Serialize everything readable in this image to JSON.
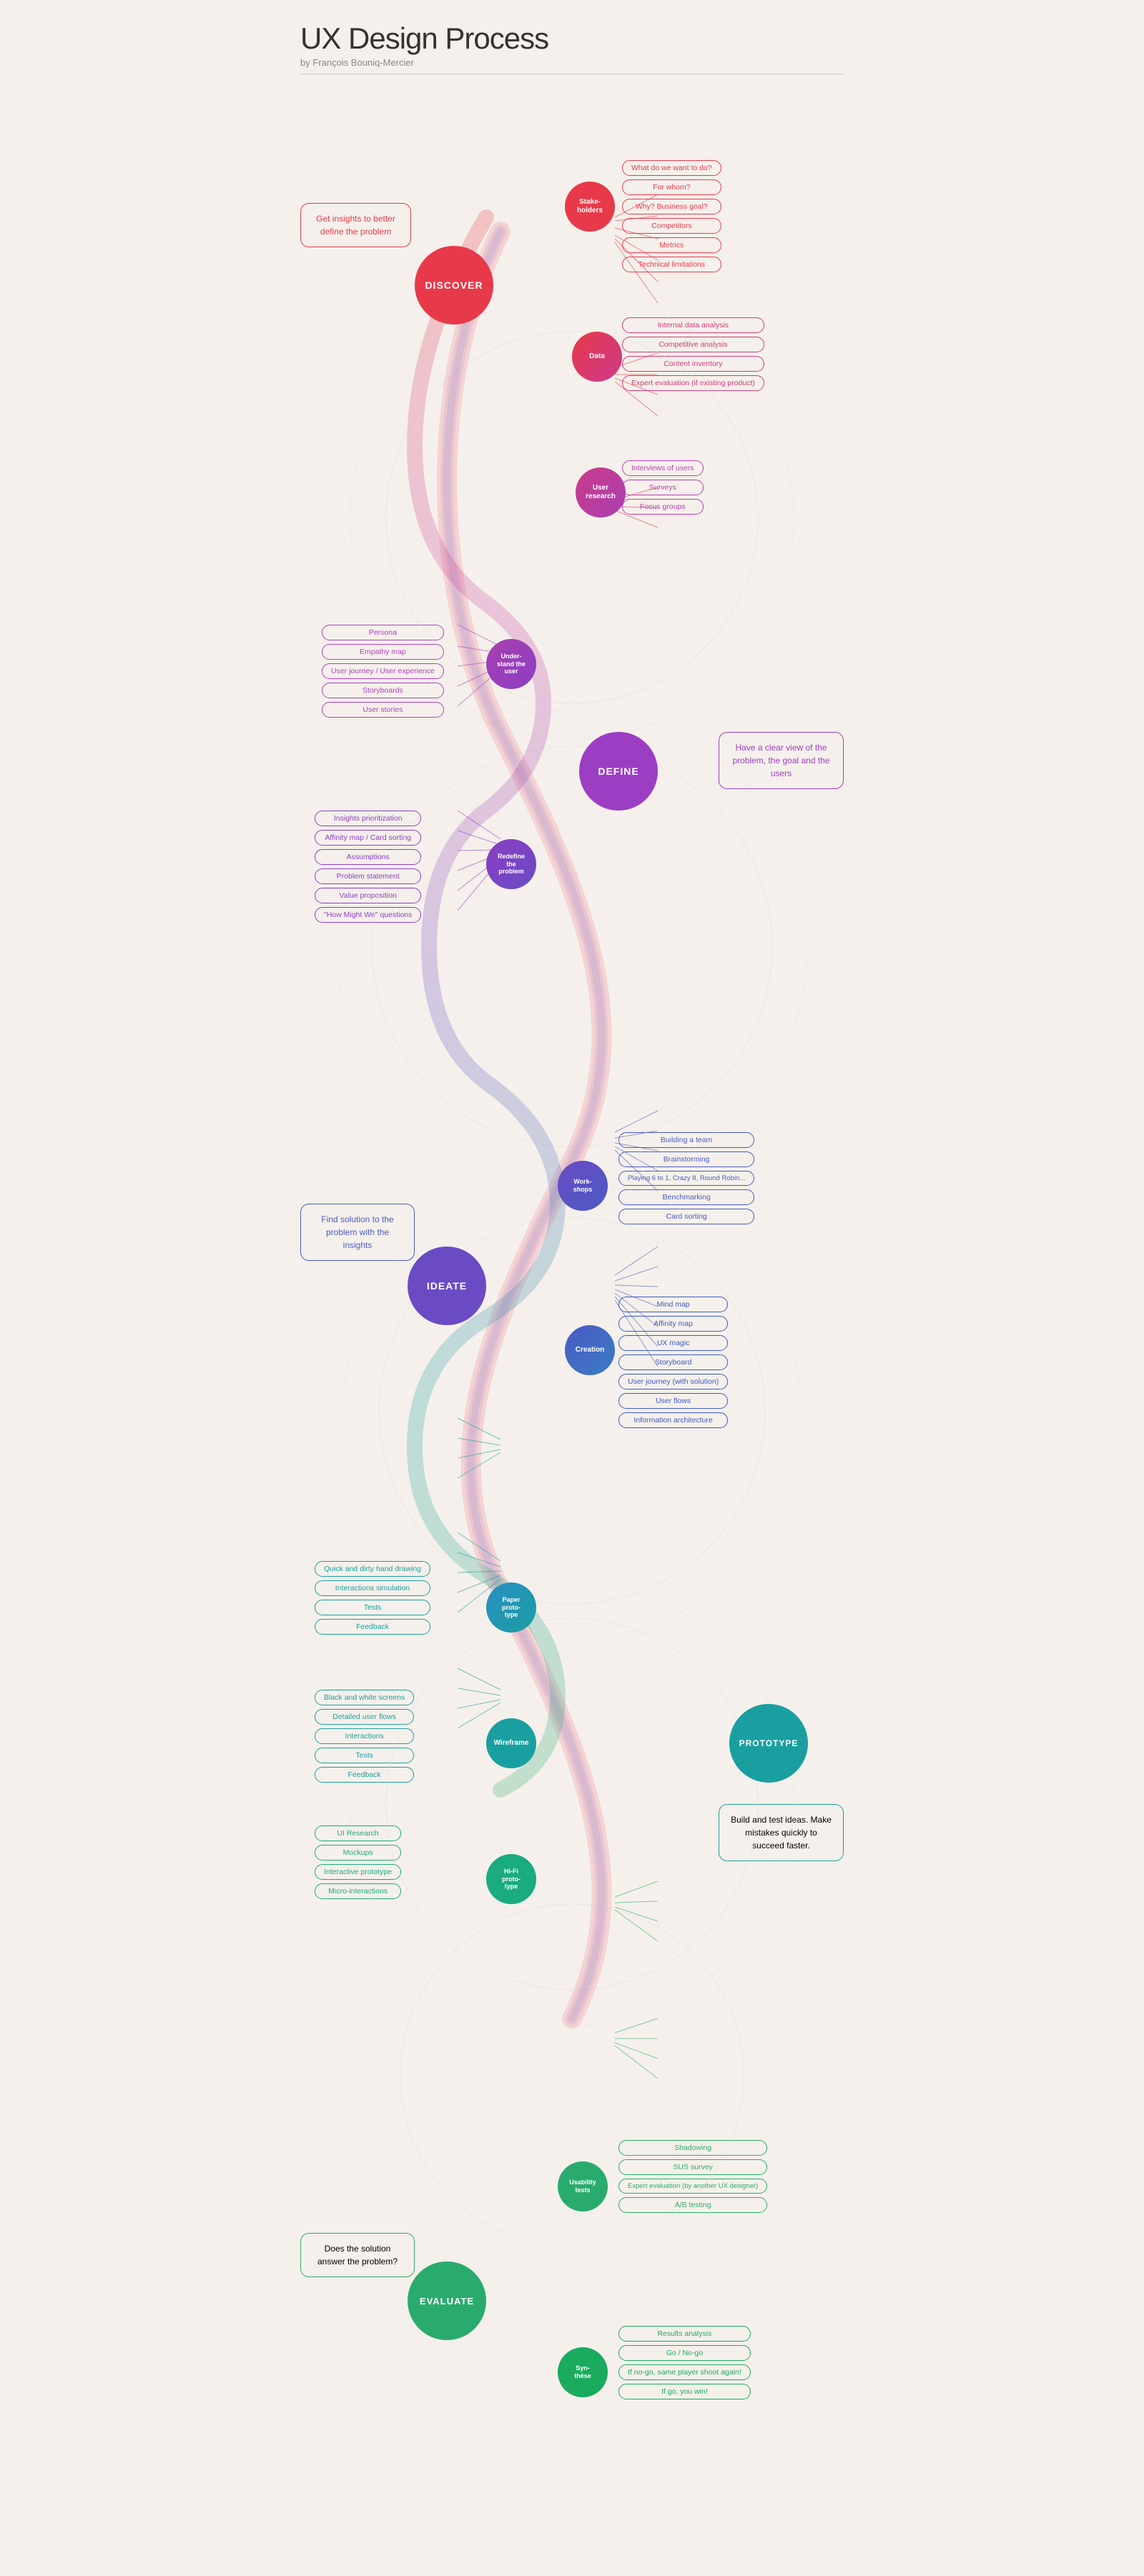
{
  "title": "UX Design Process",
  "author": "by François Bouniq-Mercier",
  "phases": {
    "discover": {
      "label": "DISCOVER",
      "description": "Get insights to better define the problem",
      "stakeholders_label": "Stake-\nholders",
      "stakeholders_pills": [
        "What do we want to do?",
        "For whom?",
        "Why? Business goal?",
        "Competitors",
        "Metrics",
        "Technical limitations"
      ],
      "data_label": "Data",
      "data_pills": [
        "Internal data analysis",
        "Competitive analysis",
        "Content inventory",
        "Expert evaluation (if existing product)"
      ],
      "user_research_label": "User\nresearch",
      "user_research_pills": [
        "Interviews of users",
        "Surveys",
        "Focus groups"
      ]
    },
    "define": {
      "label": "DEFINE",
      "description": "Have a clear view of the problem, the goal and the users",
      "understand_label": "Under-\nstand the\nuser",
      "understand_pills": [
        "Persona",
        "Empathy map",
        "User journey / User experience",
        "Storyboards",
        "User stories"
      ],
      "redefine_label": "Redefine\nthe\nproblem",
      "redefine_pills": [
        "Insights prioritization",
        "Affinity map / Card sorting",
        "Assumptions",
        "Problem statement",
        "Value proposition",
        "\"How Might We\" questions"
      ]
    },
    "ideate": {
      "label": "IDEATE",
      "description": "Find solution to the problem with the insights",
      "workshops_label": "Workshops",
      "workshops_pills": [
        "Building a team",
        "Brainstorming",
        "Playing 6 to 1, Crazy 8, Round Robin...",
        "Benchmarking",
        "Card sorting"
      ],
      "creation_label": "Creation",
      "creation_pills": [
        "Mind map",
        "Affinity map",
        "UX magic",
        "Storyboard",
        "User journey (with solution)",
        "User flows",
        "Information architecture"
      ]
    },
    "prototype": {
      "label": "PROTOTYPE",
      "description": "Build and test ideas. Make mistakes quickly to succeed faster.",
      "paper_label": "Paper\nprototype",
      "paper_pills": [
        "Quick and dirty hand drawing",
        "Interactions simulation",
        "Tests",
        "Feedback"
      ],
      "wireframe_label": "Wireframe",
      "wireframe_pills": [
        "Black and white screens",
        "Detailed user flows",
        "Interactions",
        "Tests",
        "Feedback"
      ],
      "hifi_label": "Hi-Fi\nprototype",
      "hifi_pills": [
        "UI Research",
        "Mockups",
        "Interactive prototype",
        "Micro-interactions"
      ]
    },
    "evaluate": {
      "label": "EVALUATE",
      "description": "Does the solution answer the problem?",
      "usability_label": "Usability\ntests",
      "usability_pills": [
        "Shadowing",
        "SUS survey",
        "Expert evaluation (by another UX designer)",
        "A/B testing"
      ],
      "synthese_label": "Synthèse",
      "synthese_pills": [
        "Results analysis",
        "Go / No-go",
        "If no-go, same player shoot again!",
        "If go, you win!"
      ]
    }
  }
}
